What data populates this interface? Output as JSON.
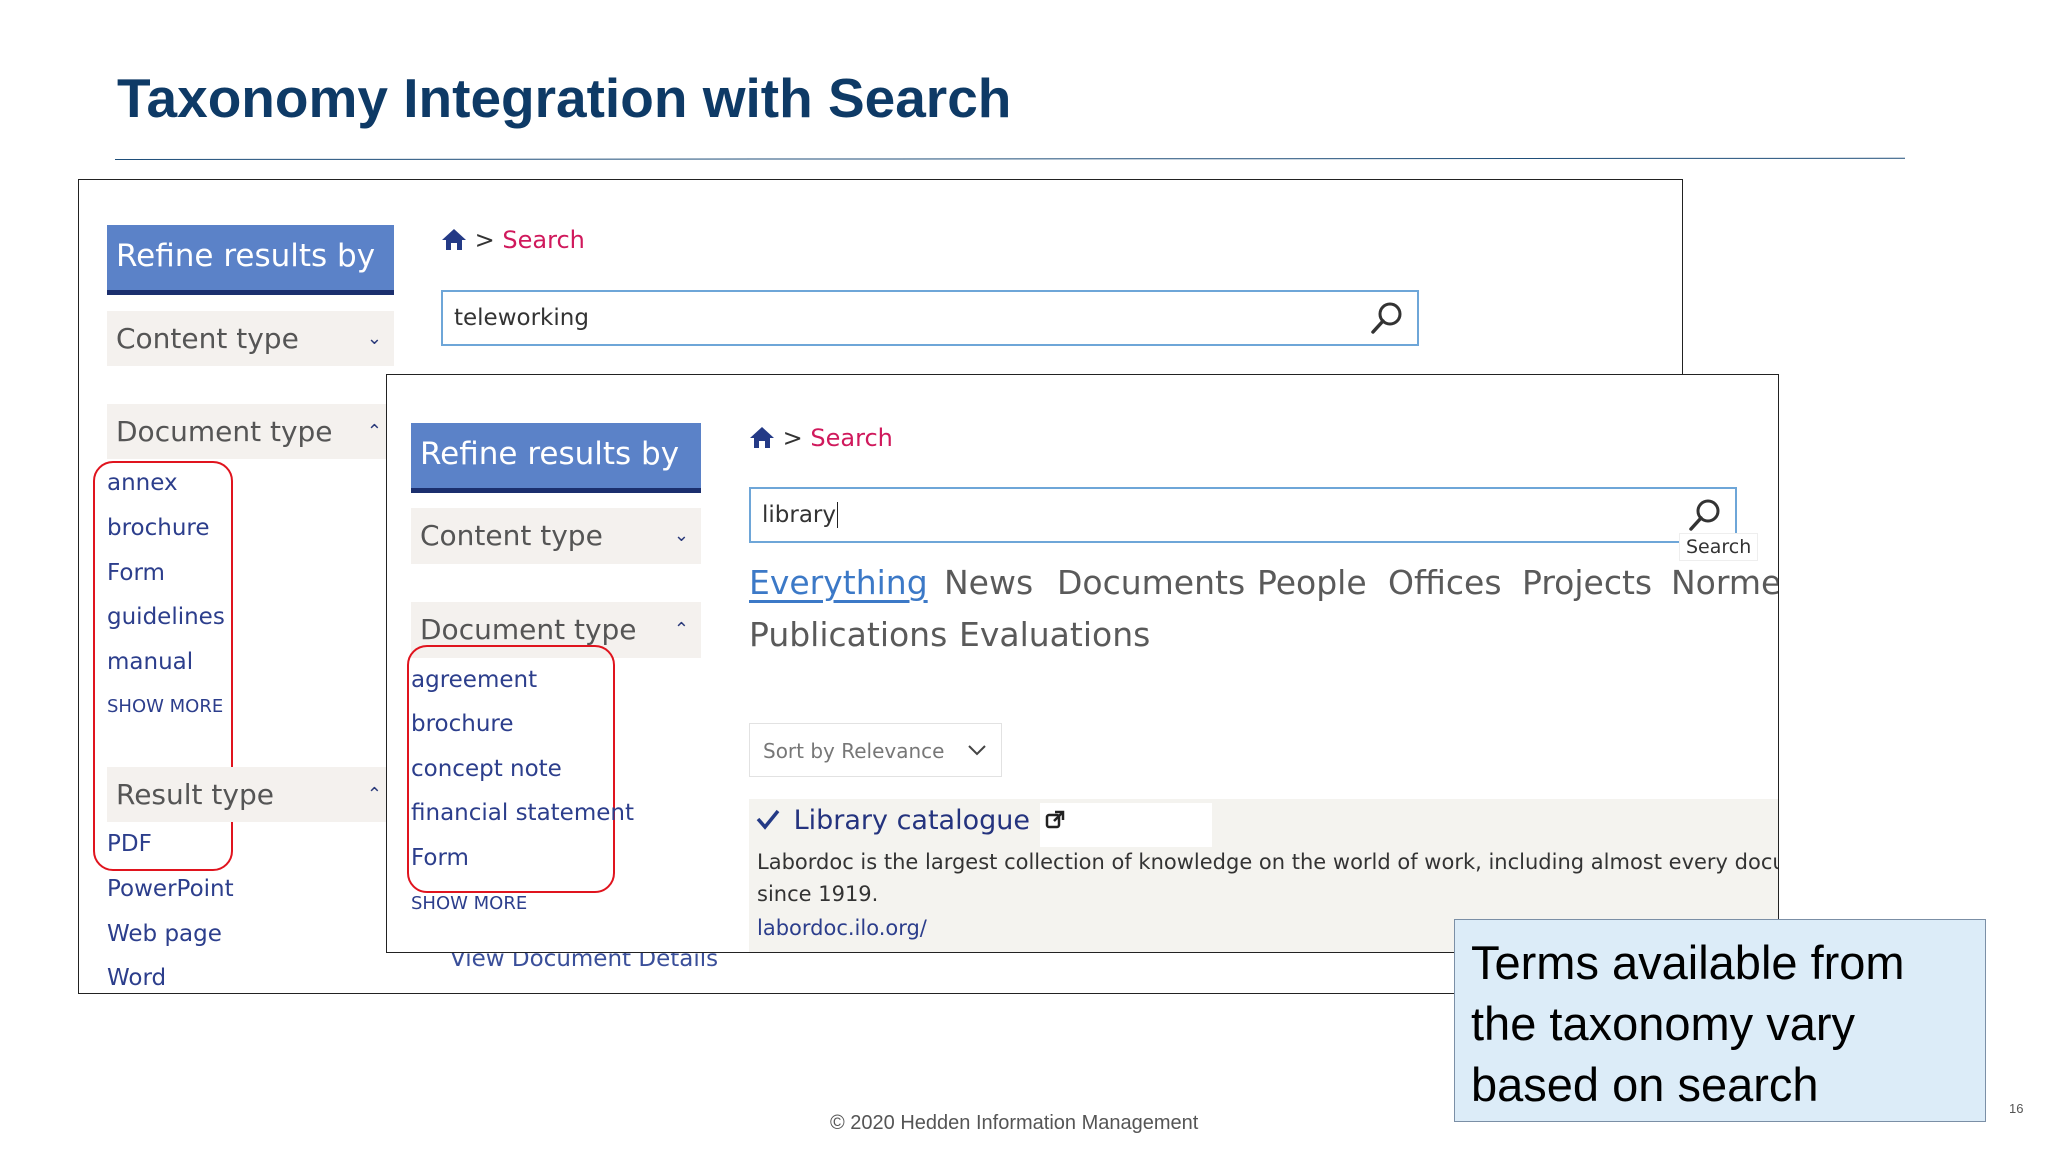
{
  "slide": {
    "title": "Taxonomy Integration with Search",
    "callout": "Terms available from the taxonomy vary based on search",
    "footer": "© 2020 Hedden Information Management",
    "page_number": "16"
  },
  "back_screen": {
    "refine_header": "Refine results by",
    "content_type_label": "Content type",
    "document_type_label": "Document type",
    "document_types": [
      "annex",
      "brochure",
      "Form",
      "guidelines",
      "manual"
    ],
    "show_more": "SHOW MORE",
    "result_type_label": "Result type",
    "result_types": [
      "PDF",
      "PowerPoint",
      "Web page",
      "Word"
    ],
    "breadcrumb": {
      "separator": ">",
      "current": "Search"
    },
    "search_query": "teleworking",
    "view_details_link": "View Document Details"
  },
  "front_screen": {
    "refine_header": "Refine results by",
    "content_type_label": "Content type",
    "document_type_label": "Document type",
    "document_types": [
      "agreement",
      "brochure",
      "concept note",
      "financial statement",
      "Form"
    ],
    "show_more": "SHOW MORE",
    "breadcrumb": {
      "separator": ">",
      "current": "Search"
    },
    "search_query": "library",
    "search_tooltip": "Search",
    "tabs": [
      "Everything",
      "News",
      "Documents",
      "People",
      "Offices",
      "Projects",
      "Normes",
      "Publications",
      "Evaluations"
    ],
    "sort_label": "Sort by Relevance",
    "result": {
      "title": "Library catalogue",
      "description_line1": "Labordoc is the largest collection of knowledge on the world of work, including almost every docume",
      "description_line2": "since 1919.",
      "url": "labordoc.ilo.org/"
    }
  },
  "colors": {
    "title": "#0e3a66",
    "refine_bg": "#5b82c8",
    "link": "#2c3e8c",
    "breadcrumb_current": "#d0195c",
    "highlight_oval": "#e0141e",
    "callout_bg": "#dcecf8"
  },
  "icons": [
    "home-icon",
    "search-icon",
    "chevron-down-icon",
    "chevron-up-icon",
    "checkmark-icon",
    "external-link-icon"
  ]
}
